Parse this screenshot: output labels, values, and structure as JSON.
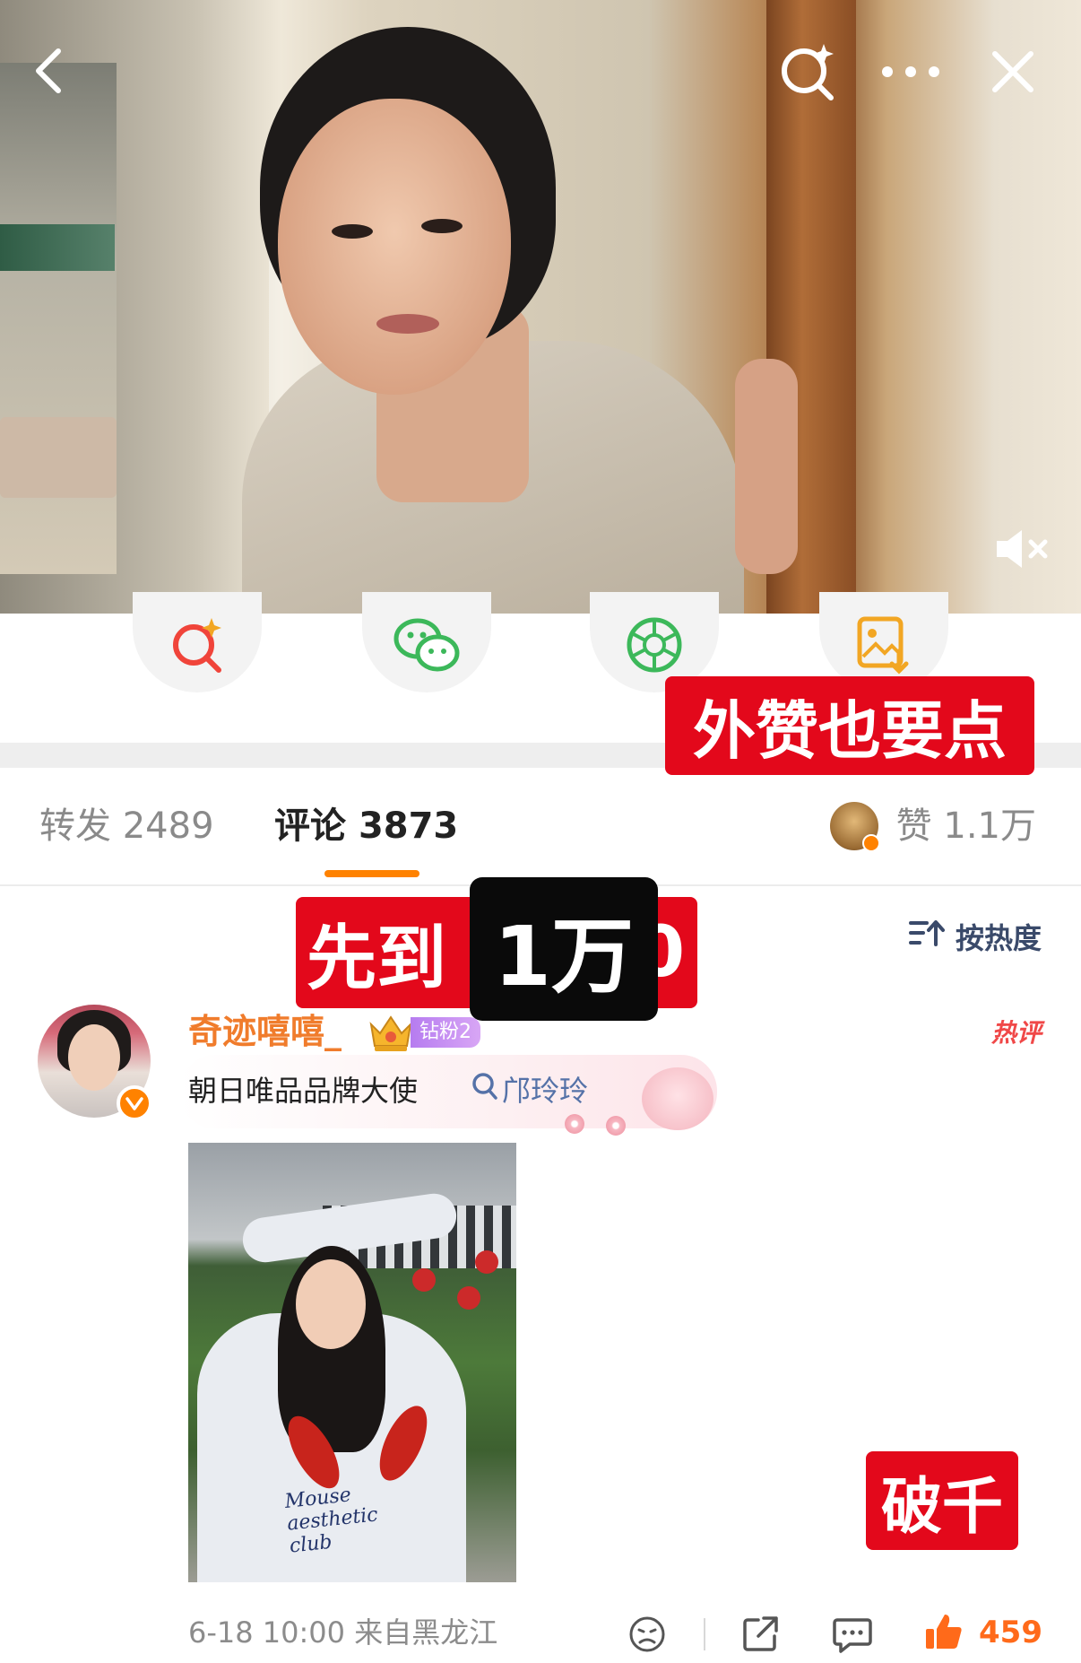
{
  "video": {
    "back_icon": "chevron-left-icon",
    "search_icon": "sparkle-search-icon",
    "more_icon": "ellipsis-icon",
    "close_icon": "close-icon",
    "mute_icon": "speaker-muted-icon"
  },
  "share_actions": [
    {
      "icon": "sparkle-search-icon",
      "color": "#f0443a"
    },
    {
      "icon": "wechat-icon",
      "color": "#3cb85a"
    },
    {
      "icon": "moments-icon",
      "color": "#3cb85a"
    },
    {
      "icon": "save-image-icon",
      "color": "#f2a623"
    }
  ],
  "stickers": {
    "top": "外赞也要点",
    "middle_red": "先到",
    "middle_red_tail": "0",
    "middle_black": "1万",
    "bottom": "破千"
  },
  "tabs": {
    "repost_label": "转发",
    "repost_count": "2489",
    "comment_label": "评论",
    "comment_count": "3873",
    "like_label": "赞",
    "like_count": "1.1万"
  },
  "sort": {
    "label": "按热度",
    "icon": "sort-icon"
  },
  "comment": {
    "username": "奇迹嘻嘻_",
    "fan_badge": "钻粉2",
    "hot_tag": "热评",
    "text": "朝日唯品品牌大使",
    "search_link": "邝玲玲",
    "photo_text": "Mouse aesthetic club",
    "time": "6-18 10:00",
    "location": "来自黑龙江",
    "likes": "459",
    "icons": [
      "sad-face-icon",
      "share-icon",
      "comment-icon",
      "thumbs-up-icon"
    ]
  },
  "colors": {
    "accent": "#ff8200",
    "username": "#f07c2c",
    "link": "#5572a8",
    "like": "#ff6a1a",
    "sticker_red": "#e3081b"
  }
}
